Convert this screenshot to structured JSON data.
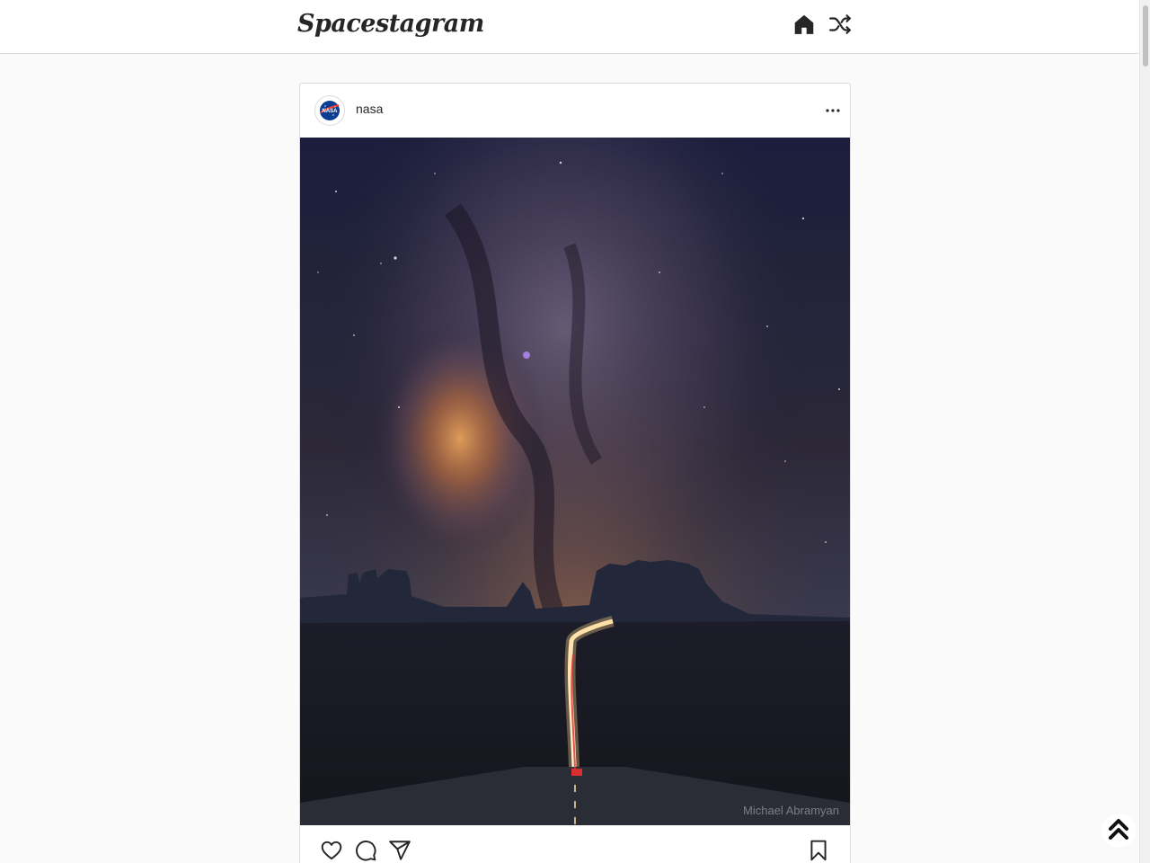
{
  "app": {
    "logo_text": "Spacestagram"
  },
  "nav": {
    "home_icon": "home-icon",
    "shuffle_icon": "shuffle-icon"
  },
  "post": {
    "username": "nasa",
    "avatar_icon": "nasa-logo-icon",
    "image_alt": "Milky Way over a desert road with buttes",
    "photo_credit": "Michael Abramyan",
    "actions": [
      "heart-icon",
      "comment-icon",
      "share-icon",
      "bookmark-icon"
    ]
  },
  "scroll_to_top_icon": "double-chevron-up-icon",
  "colors": {
    "text": "#262626",
    "background": "#fafafa",
    "border": "#dbdbdb"
  }
}
